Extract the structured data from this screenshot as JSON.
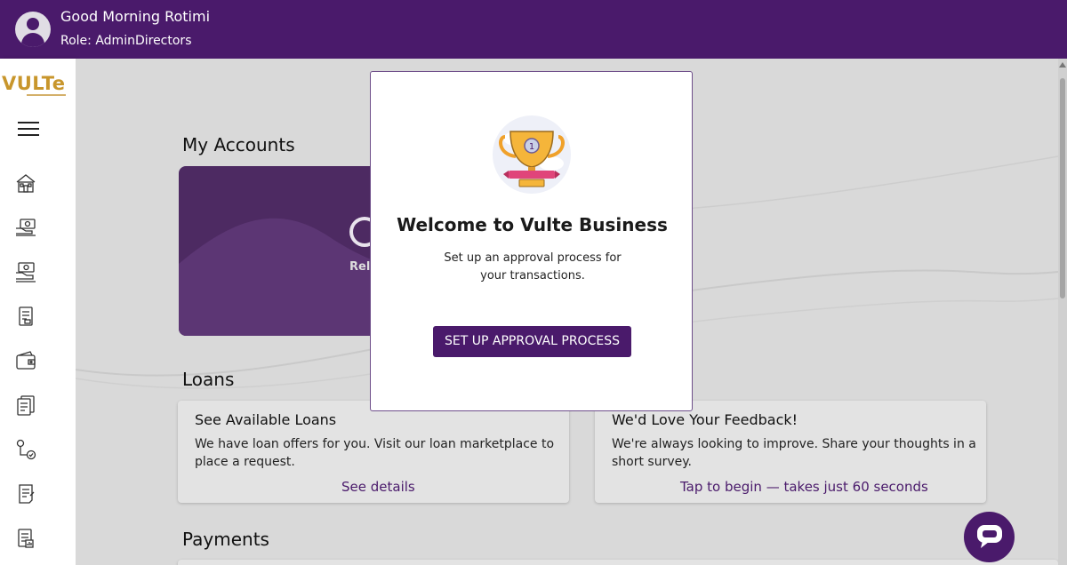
{
  "header": {
    "greeting": "Good Morning Rotimi",
    "role": "Role: AdminDirectors",
    "avatar_icon": "user-avatar-icon"
  },
  "sidebar": {
    "logo_text": "VULTe",
    "menu_icon": "hamburger-menu-icon",
    "nav_icons": [
      "home-icon",
      "cash-transfer-icon",
      "cash-payment-icon",
      "statement-document-icon",
      "wallet-icon",
      "documents-icon",
      "approval-flow-icon",
      "invoice-icon",
      "report-icon"
    ]
  },
  "main": {
    "my_accounts_title": "My Accounts",
    "accounts_reload_text": "Relo",
    "loans_title": "Loans",
    "payments_title": "Payments",
    "obscured_title_fragment": "y",
    "loans_card": {
      "title": "See Available Loans",
      "text": "We have loan offers for you. Visit our loan marketplace to place a request.",
      "link": "See details"
    },
    "feedback_card": {
      "title": "We'd Love Your Feedback!",
      "text": "We're always looking to improve. Share your thoughts in a short survey.",
      "link": "Tap to begin — takes just 60 seconds"
    }
  },
  "modal": {
    "icon": "trophy-icon",
    "title": "Welcome to Vulte Business",
    "text": "Set up an approval process for your transactions.",
    "button_label": "SET UP APPROVAL PROCESS"
  },
  "chat": {
    "icon": "chat-bubble-icon"
  },
  "colors": {
    "brand_purple": "#4a1a6b",
    "logo_gold": "#c8962c",
    "overlay_gray": "#d9d9d9"
  }
}
